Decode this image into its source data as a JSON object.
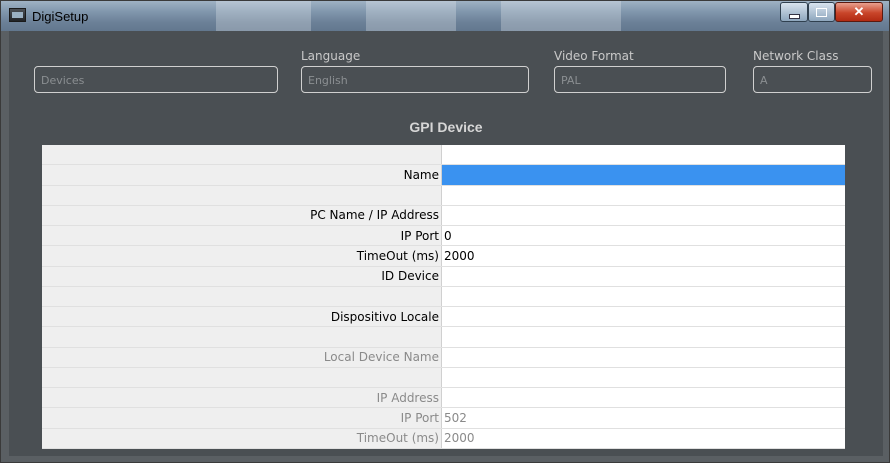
{
  "window": {
    "title": "DigiSetup"
  },
  "header": {
    "devices": {
      "value": "Devices"
    },
    "language": {
      "label": "Language",
      "value": "English"
    },
    "video_format": {
      "label": "Video Format",
      "value": "PAL"
    },
    "network_class": {
      "label": "Network Class",
      "value": "A"
    }
  },
  "section": {
    "title": "GPI Device"
  },
  "grid": {
    "rows": [
      {
        "label": "",
        "value": ""
      },
      {
        "label": "Name",
        "value": ""
      },
      {
        "label": "",
        "value": ""
      },
      {
        "label": "PC Name / IP Address",
        "value": ""
      },
      {
        "label": "IP Port",
        "value": "0"
      },
      {
        "label": "TimeOut (ms)",
        "value": "2000"
      },
      {
        "label": "ID Device",
        "value": ""
      },
      {
        "label": "",
        "value": ""
      },
      {
        "label": "Dispositivo Locale",
        "value": ""
      },
      {
        "label": "",
        "value": ""
      },
      {
        "label": "Local Device Name",
        "value": ""
      },
      {
        "label": "",
        "value": ""
      },
      {
        "label": "IP Address",
        "value": ""
      },
      {
        "label": "IP Port",
        "value": "502"
      },
      {
        "label": "TimeOut (ms)",
        "value": "2000"
      }
    ]
  },
  "icons": {
    "app": "app-window-icon",
    "minimize": "minimize-icon",
    "maximize": "maximize-icon",
    "close": "close-icon"
  },
  "colors": {
    "selection": "#3a92f0",
    "client_bg": "#4a4f53"
  }
}
